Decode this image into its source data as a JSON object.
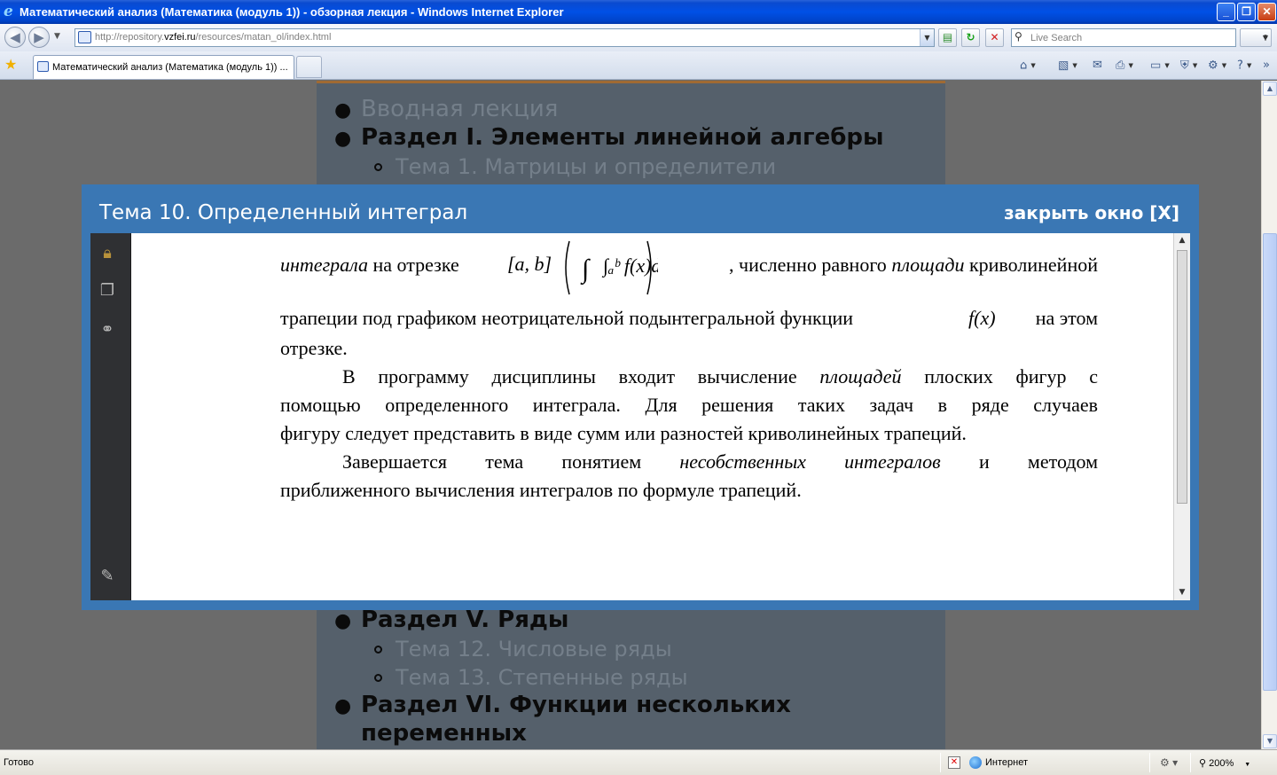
{
  "window": {
    "title": "Математический анализ (Математика (модуль 1)) - обзорная лекция - Windows Internet Explorer",
    "minimize_glyph": "_",
    "maximize_glyph": "❐",
    "close_glyph": "✕"
  },
  "address_bar": {
    "url_prefix": "http://repository.",
    "url_domain": "vzfei.ru",
    "url_rest": "/resources/matan_ol/index.html",
    "search_placeholder": "Live Search",
    "icons": [
      "back-arrow-icon",
      "forward-arrow-icon",
      "page-icon",
      "compatibility-icon",
      "refresh-icon",
      "stop-icon",
      "search-icon"
    ]
  },
  "tabs": {
    "active_label": "Математический анализ (Математика (модуль 1)) ...",
    "command_icons": [
      "home-icon",
      "feeds-icon",
      "mail-icon",
      "print-icon",
      "page-menu-icon",
      "safety-icon",
      "tools-icon",
      "help-icon"
    ]
  },
  "toc": {
    "items": [
      {
        "kind": "top",
        "text": "Вводная лекция"
      },
      {
        "kind": "section",
        "text": "Раздел I. Элементы линейной алгебры"
      },
      {
        "kind": "sub",
        "text": "Тема 1. Матрицы и определители"
      },
      {
        "kind": "section",
        "text": "Раздел V. Ряды"
      },
      {
        "kind": "sub",
        "text": "Тема 12. Числовые ряды"
      },
      {
        "kind": "sub",
        "text": "Тема 13. Степенные ряды"
      },
      {
        "kind": "section",
        "text": "Раздел VI. Функции нескольких"
      },
      {
        "kind": "section_cont",
        "text": "переменных"
      }
    ]
  },
  "modal": {
    "title": "Тема 10. Определенный интеграл",
    "close_label": "закрыть окно [X]",
    "pdf_sidebar_icons": [
      "lock-icon",
      "pages-icon",
      "binoculars-icon",
      "attachment-icon"
    ],
    "document": {
      "line1_a": "интеграла",
      "line1_b": " на отрезке ",
      "line1_formula_interval": "[a, b]",
      "line1_formula_integral": "∫ₐᵇ f(x)dx",
      "line1_c": ", численно равного ",
      "line1_d": "площади",
      "line1_e": " криволинейной",
      "line2": "трапеции под графиком неотрицательной подынтегральной функции",
      "line2_formula": "f(x)",
      "line2_end": "на этом",
      "line3": "отрезке.",
      "p2_line1_a": "В программу дисциплины входит вычисление ",
      "p2_line1_b": "площадей",
      "p2_line1_c": " плоских фигур с",
      "p2_line2": "помощью определенного интеграла. Для решения таких задач в ряде случаев",
      "p2_line3": "фигуру следует представить в виде сумм или разностей криволинейных трапеций.",
      "p3_line1_a": "Завершается тема понятием ",
      "p3_line1_b": "несобственных интегралов",
      "p3_line1_c": " и методом",
      "p3_line2": "приближенного вычисления интегралов по формуле трапеций."
    }
  },
  "status_bar": {
    "status": "Готово",
    "zone": "Интернет",
    "zoom": "200%"
  }
}
